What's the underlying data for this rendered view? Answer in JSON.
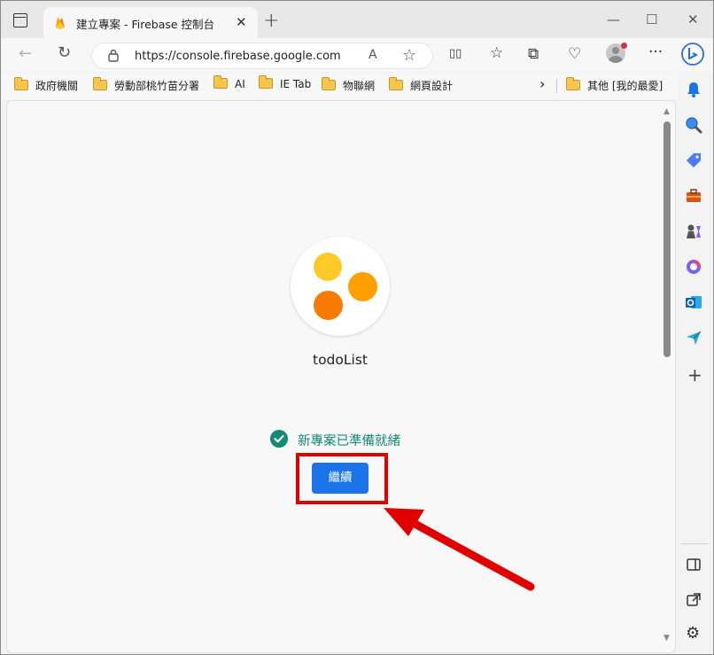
{
  "window": {
    "tab_title": "建立專案 - Firebase 控制台",
    "close_tab": "✕",
    "new_tab": "+",
    "minimize": "—",
    "maximize": "☐",
    "close": "✕"
  },
  "navbar": {
    "back": "←",
    "refresh": "↻",
    "url": "https://console.firebase.google.com",
    "read_aloud": "A",
    "favorite": "☆"
  },
  "toolbar": {
    "split": "▯▯",
    "favorites": "☆",
    "collections": "⧉",
    "health": "♡",
    "more": "···"
  },
  "bookmarks": [
    {
      "label": "政府機關"
    },
    {
      "label": "勞動部桃竹苗分署"
    },
    {
      "label": "AI"
    },
    {
      "label": "IE Tab"
    },
    {
      "label": "物聯網"
    },
    {
      "label": "網頁設計"
    }
  ],
  "bookmarks_overflow": "›",
  "bookmarks_other": "其他 [我的最愛]",
  "page": {
    "project_name": "todoList",
    "ready_text": "新專案已準備就緒",
    "continue_label": "繼續"
  },
  "colors": {
    "accent_blue": "#1a73e8",
    "success_green": "#138a74",
    "highlight_red": "#e00000",
    "logo_yellow": "#ffca28",
    "logo_orange": "#ffa000",
    "logo_dark_orange": "#f57c00"
  },
  "sidebar": {
    "icons": [
      "bell-icon",
      "search-icon",
      "tag-icon",
      "toolbox-icon",
      "games-icon",
      "office-icon",
      "outlook-icon",
      "send-icon",
      "add-icon",
      "split-screen-icon",
      "external-link-icon",
      "settings-icon"
    ],
    "add": "+",
    "settings": "⚙"
  }
}
